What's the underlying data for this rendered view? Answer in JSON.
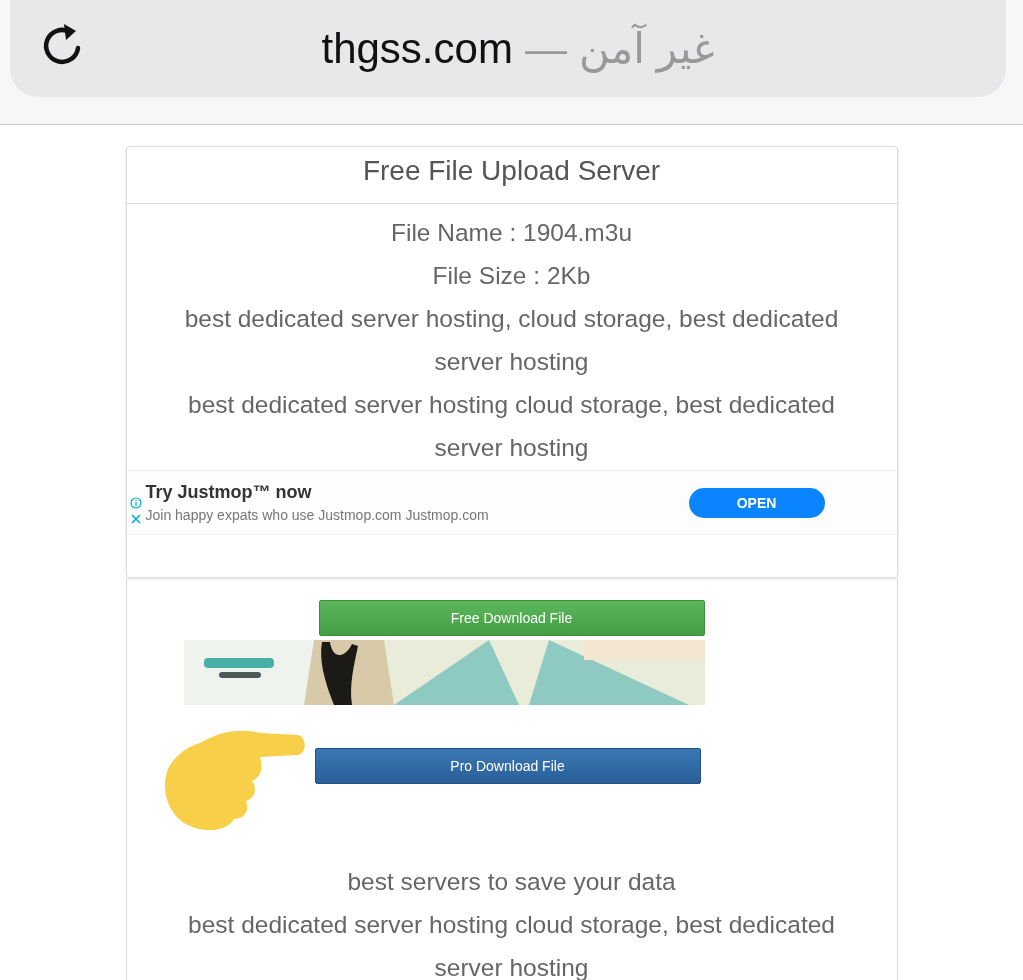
{
  "address_bar": {
    "domain": "thgss.com",
    "separator": "—",
    "security_label": "غير آمن"
  },
  "card": {
    "title": "Free File Upload Server",
    "details": [
      "File Name : 1904.m3u",
      "File Size : 2Kb",
      "best dedicated server hosting, cloud storage, best dedicated server hosting",
      "best dedicated server hosting cloud storage, best dedicated server hosting"
    ],
    "ad": {
      "headline": "Try Justmop™ now",
      "description": "Join happy expats who use Justmop.com Justmop.com",
      "button": "OPEN"
    }
  },
  "download": {
    "items": [
      {
        "kind": "free_button",
        "label": "Free Download File"
      },
      {
        "kind": "picture"
      },
      {
        "kind": "pro_button",
        "label": "Pro Download File"
      }
    ],
    "footer_lines": [
      "best servers to save your data",
      "best dedicated server hosting cloud storage, best dedicated server hosting"
    ]
  }
}
